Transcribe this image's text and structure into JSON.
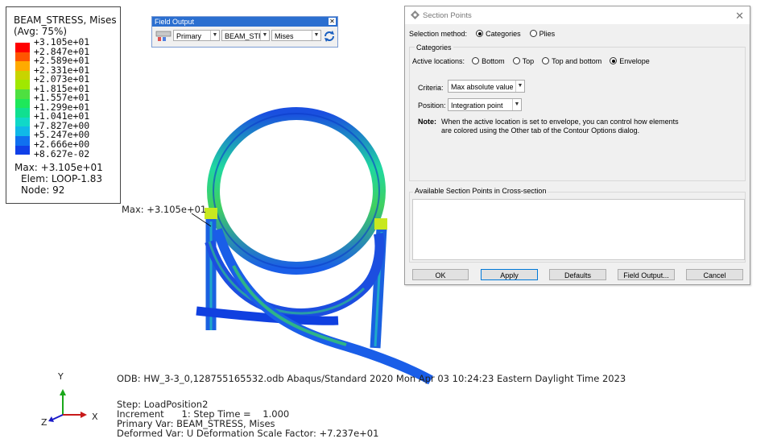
{
  "legend": {
    "title_line1": "BEAM_STRESS, Mises",
    "title_line2": "(Avg: 75%)",
    "values": [
      "+3.105e+01",
      "+2.847e+01",
      "+2.589e+01",
      "+2.331e+01",
      "+2.073e+01",
      "+1.815e+01",
      "+1.557e+01",
      "+1.299e+01",
      "+1.041e+01",
      "+7.827e+00",
      "+5.247e+00",
      "+2.666e+00",
      "+8.627e-02"
    ],
    "colors": [
      "#ff0000",
      "#ff5500",
      "#ffaa00",
      "#c8d400",
      "#a0e800",
      "#4ee040",
      "#1ee85a",
      "#10e090",
      "#10d8c8",
      "#10b8e8",
      "#1070f0",
      "#1040e8",
      "#0000c8"
    ],
    "max": "Max: +3.105e+01",
    "elem": "Elem: LOOP-1.83",
    "node": "Node: 92"
  },
  "field_output": {
    "title": "Field Output",
    "step_icon": "step-icon",
    "primary": "Primary",
    "variable": "BEAM_STRES",
    "invariant": "Mises"
  },
  "max_label": "Max: +3.105e+01",
  "section_points": {
    "title": "Section Points",
    "selection_method_label": "Selection method:",
    "opt_categories": "Categories",
    "opt_plies": "Plies",
    "categories_group": "Categories",
    "active_locations_label": "Active locations:",
    "loc_bottom": "Bottom",
    "loc_top": "Top",
    "loc_top_bottom": "Top and bottom",
    "loc_envelope": "Envelope",
    "criteria_label": "Criteria:",
    "criteria_value": "Max absolute value",
    "position_label": "Position:",
    "position_value": "Integration point",
    "note_label": "Note:",
    "note_line1": "When the active location is set to envelope, you can control how elements",
    "note_line2": "are colored using the Other tab of the Contour Options dialog.",
    "available_label": "Available Section Points in Cross-section",
    "buttons": {
      "ok": "OK",
      "apply": "Apply",
      "defaults": "Defaults",
      "field_output": "Field Output...",
      "cancel": "Cancel"
    }
  },
  "odb_line": "ODB: HW_3-3_0,128755165532.odb    Abaqus/Standard 2020    Mon Apr 03 10:24:23 Eastern Daylight Time 2023",
  "step_info": {
    "step": "Step: LoadPosition2",
    "increment": "Increment      1: Step Time =    1.000",
    "primary_var": "Primary Var: BEAM_STRESS, Mises",
    "deformed_var": "Deformed Var: U   Deformation Scale Factor: +7.237e+01"
  },
  "triad": {
    "x": "X",
    "y": "Y",
    "z": "Z"
  }
}
